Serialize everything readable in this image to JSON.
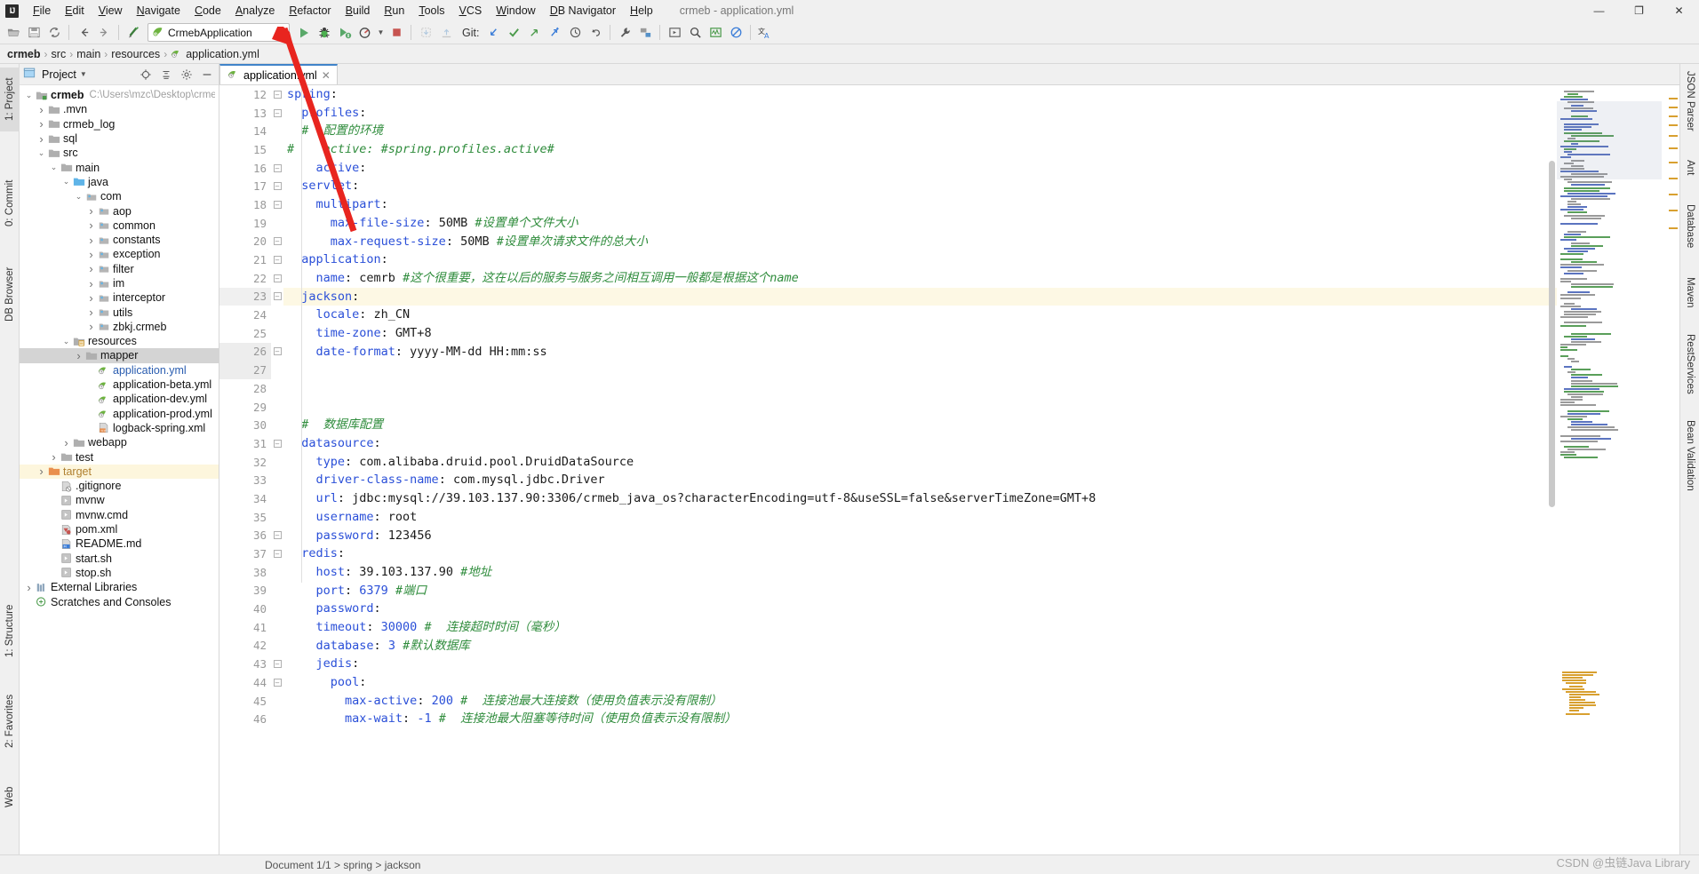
{
  "window": {
    "title": "crmeb - application.yml",
    "controls": {
      "minimize": "—",
      "maximize": "❐",
      "close": "✕"
    }
  },
  "menubar": {
    "items": [
      "File",
      "Edit",
      "View",
      "Navigate",
      "Code",
      "Analyze",
      "Refactor",
      "Build",
      "Run",
      "Tools",
      "VCS",
      "Window",
      "DB Navigator",
      "Help"
    ]
  },
  "toolbar": {
    "run_config": "CrmebApplication",
    "git_label": "Git:",
    "buttons": [
      "open-project-icon",
      "save-all-icon",
      "sync-icon",
      "back-icon",
      "forward-icon",
      "build-icon",
      "run-icon",
      "debug-icon",
      "run-coverage-icon",
      "profile-icon",
      "stop-icon",
      "update-project-icon",
      "commit-icon",
      "git-pull-icon",
      "git-commit-check-icon",
      "git-push-icon",
      "git-update-icon",
      "history-icon",
      "rollback-icon",
      "settings-wrench-icon",
      "project-structure-icon",
      "run-anything-icon",
      "search-everywhere-icon",
      "activity-monitor-icon",
      "no-access-icon",
      "translate-icon"
    ]
  },
  "breadcrumb": {
    "items": [
      "crmeb",
      "src",
      "main",
      "resources",
      "application.yml"
    ]
  },
  "left_tool_tabs": [
    "1: Project",
    "0: Commit",
    "DB Browser"
  ],
  "right_tool_tabs": [
    "JSON Parser",
    "Ant",
    "Database",
    "Maven",
    "RestServices",
    "Bean Validation"
  ],
  "bottom_left_tool_tabs": [
    "1: Structure",
    "2: Favorites",
    "Web"
  ],
  "project_panel": {
    "title": "Project",
    "header_icons": [
      "locate-icon",
      "collapse-all-icon",
      "gear-icon",
      "hide-icon"
    ],
    "tree": [
      {
        "label": "crmeb",
        "path": "C:\\Users\\mzc\\Desktop\\crmeb\\cr",
        "indent": 0,
        "arrow": "down",
        "icon": "module-folder",
        "bold": true
      },
      {
        "label": ".mvn",
        "indent": 1,
        "arrow": "right",
        "icon": "folder"
      },
      {
        "label": "crmeb_log",
        "indent": 1,
        "arrow": "right",
        "icon": "folder"
      },
      {
        "label": "sql",
        "indent": 1,
        "arrow": "right",
        "icon": "folder"
      },
      {
        "label": "src",
        "indent": 1,
        "arrow": "down",
        "icon": "folder"
      },
      {
        "label": "main",
        "indent": 2,
        "arrow": "down",
        "icon": "folder"
      },
      {
        "label": "java",
        "indent": 3,
        "arrow": "down",
        "icon": "source-folder"
      },
      {
        "label": "com",
        "indent": 4,
        "arrow": "down",
        "icon": "package"
      },
      {
        "label": "aop",
        "indent": 5,
        "arrow": "right",
        "icon": "package"
      },
      {
        "label": "common",
        "indent": 5,
        "arrow": "right",
        "icon": "package"
      },
      {
        "label": "constants",
        "indent": 5,
        "arrow": "right",
        "icon": "package"
      },
      {
        "label": "exception",
        "indent": 5,
        "arrow": "right",
        "icon": "package"
      },
      {
        "label": "filter",
        "indent": 5,
        "arrow": "right",
        "icon": "package"
      },
      {
        "label": "im",
        "indent": 5,
        "arrow": "right",
        "icon": "package"
      },
      {
        "label": "interceptor",
        "indent": 5,
        "arrow": "right",
        "icon": "package"
      },
      {
        "label": "utils",
        "indent": 5,
        "arrow": "right",
        "icon": "package"
      },
      {
        "label": "zbkj.crmeb",
        "indent": 5,
        "arrow": "right",
        "icon": "package"
      },
      {
        "label": "resources",
        "indent": 3,
        "arrow": "down",
        "icon": "resource-folder"
      },
      {
        "label": "mapper",
        "indent": 4,
        "arrow": "right",
        "icon": "folder",
        "selected": true
      },
      {
        "label": "application.yml",
        "indent": 5,
        "icon": "yml-file",
        "color": "blue"
      },
      {
        "label": "application-beta.yml",
        "indent": 5,
        "icon": "yml-file"
      },
      {
        "label": "application-dev.yml",
        "indent": 5,
        "icon": "yml-file"
      },
      {
        "label": "application-prod.yml",
        "indent": 5,
        "icon": "yml-file"
      },
      {
        "label": "logback-spring.xml",
        "indent": 5,
        "icon": "xml-file"
      },
      {
        "label": "webapp",
        "indent": 3,
        "arrow": "right",
        "icon": "folder"
      },
      {
        "label": "test",
        "indent": 2,
        "arrow": "right",
        "icon": "folder"
      },
      {
        "label": "target",
        "indent": 1,
        "arrow": "right",
        "icon": "excluded-folder",
        "color": "orange",
        "highlight": true
      },
      {
        "label": ".gitignore",
        "indent": 2,
        "icon": "gitignore-file"
      },
      {
        "label": "mvnw",
        "indent": 2,
        "icon": "script-file"
      },
      {
        "label": "mvnw.cmd",
        "indent": 2,
        "icon": "script-file"
      },
      {
        "label": "pom.xml",
        "indent": 2,
        "icon": "maven-file"
      },
      {
        "label": "README.md",
        "indent": 2,
        "icon": "md-file"
      },
      {
        "label": "start.sh",
        "indent": 2,
        "icon": "sh-file"
      },
      {
        "label": "stop.sh",
        "indent": 2,
        "icon": "sh-file"
      },
      {
        "label": "External Libraries",
        "indent": 0,
        "arrow": "right",
        "icon": "libraries"
      },
      {
        "label": "Scratches and Consoles",
        "indent": 0,
        "icon": "scratches"
      }
    ]
  },
  "editor": {
    "tab": {
      "label": "application.yml",
      "icon": "yml-file",
      "close": "✕"
    },
    "warning_count": "11",
    "first_line_number": 12,
    "lines": [
      {
        "n": 12,
        "fold": "minus",
        "tokens": [
          {
            "t": "spring",
            "c": "k"
          },
          {
            "t": ":",
            "c": "v"
          }
        ]
      },
      {
        "n": 13,
        "fold": "minus",
        "tokens": [
          {
            "t": "  profiles",
            "c": "k"
          },
          {
            "t": ":",
            "c": "v"
          }
        ]
      },
      {
        "n": 14,
        "tokens": [
          {
            "t": "  #  配置的环境",
            "c": "cm"
          }
        ]
      },
      {
        "n": 15,
        "tokens": [
          {
            "t": "#    active: #spring.profiles.active#",
            "c": "cm"
          }
        ]
      },
      {
        "n": 16,
        "fold": "minus",
        "tokens": [
          {
            "t": "    active",
            "c": "k"
          },
          {
            "t": ":",
            "c": "v"
          }
        ]
      },
      {
        "n": 17,
        "fold": "minus",
        "tokens": [
          {
            "t": "  servlet",
            "c": "k"
          },
          {
            "t": ":",
            "c": "v"
          }
        ]
      },
      {
        "n": 18,
        "fold": "minus",
        "tokens": [
          {
            "t": "    multipart",
            "c": "k"
          },
          {
            "t": ":",
            "c": "v"
          }
        ]
      },
      {
        "n": 19,
        "tokens": [
          {
            "t": "      max-file-size",
            "c": "k"
          },
          {
            "t": ": 50MB ",
            "c": "v"
          },
          {
            "t": "#设置单个文件大小",
            "c": "cm"
          }
        ]
      },
      {
        "n": 20,
        "fold": "minus",
        "tokens": [
          {
            "t": "      max-request-size",
            "c": "k"
          },
          {
            "t": ": 50MB ",
            "c": "v"
          },
          {
            "t": "#设置单次请求文件的总大小",
            "c": "cm"
          }
        ]
      },
      {
        "n": 21,
        "fold": "minus",
        "tokens": [
          {
            "t": "  application",
            "c": "k"
          },
          {
            "t": ":",
            "c": "v"
          }
        ]
      },
      {
        "n": 22,
        "fold": "minus",
        "tokens": [
          {
            "t": "    name",
            "c": "k"
          },
          {
            "t": ": cemrb ",
            "c": "v"
          },
          {
            "t": "#这个很重要，这在以后的服务与服务之间相互调用一般都是根据这个name",
            "c": "cm"
          }
        ]
      },
      {
        "n": 23,
        "fold": "minus",
        "highlight": true,
        "tokens": [
          {
            "t": "  jackson",
            "c": "k"
          },
          {
            "t": ":",
            "c": "v"
          }
        ]
      },
      {
        "n": 24,
        "tokens": [
          {
            "t": "    locale",
            "c": "k"
          },
          {
            "t": ": zh_CN",
            "c": "v"
          }
        ]
      },
      {
        "n": 25,
        "tokens": [
          {
            "t": "    time-zone",
            "c": "k"
          },
          {
            "t": ": GMT+8",
            "c": "v"
          }
        ]
      },
      {
        "n": 26,
        "fold": "minus",
        "tokens": [
          {
            "t": "    date-format",
            "c": "k"
          },
          {
            "t": ": yyyy-MM-dd HH:mm:ss",
            "c": "v"
          }
        ]
      },
      {
        "n": 27,
        "tokens": []
      },
      {
        "n": 28,
        "tokens": []
      },
      {
        "n": 29,
        "tokens": []
      },
      {
        "n": 30,
        "tokens": [
          {
            "t": "  #  数据库配置",
            "c": "cm"
          }
        ]
      },
      {
        "n": 31,
        "fold": "minus",
        "tokens": [
          {
            "t": "  datasource",
            "c": "k"
          },
          {
            "t": ":",
            "c": "v"
          }
        ]
      },
      {
        "n": 32,
        "tokens": [
          {
            "t": "    type",
            "c": "k"
          },
          {
            "t": ": com.alibaba.druid.pool.DruidDataSource",
            "c": "v"
          }
        ]
      },
      {
        "n": 33,
        "tokens": [
          {
            "t": "    driver-class-name",
            "c": "k"
          },
          {
            "t": ": com.mysql.jdbc.Driver",
            "c": "v"
          }
        ]
      },
      {
        "n": 34,
        "changed": true,
        "tokens": [
          {
            "t": "    url",
            "c": "k"
          },
          {
            "t": ": jdbc:mysql://39.103.137.90:3306/crmeb_java_os?characterEncoding=utf-8&useSSL=false&serverTimeZone=GMT+8",
            "c": "v"
          }
        ]
      },
      {
        "n": 35,
        "tokens": [
          {
            "t": "    username",
            "c": "k"
          },
          {
            "t": ": root",
            "c": "v"
          }
        ]
      },
      {
        "n": 36,
        "fold": "minus",
        "tokens": [
          {
            "t": "    password",
            "c": "k"
          },
          {
            "t": ": 123456",
            "c": "v"
          }
        ]
      },
      {
        "n": 37,
        "fold": "minus",
        "changed": true,
        "tokens": [
          {
            "t": "  redis",
            "c": "k"
          },
          {
            "t": ":",
            "c": "v"
          }
        ]
      },
      {
        "n": 38,
        "changed": true,
        "tokens": [
          {
            "t": "    host",
            "c": "k"
          },
          {
            "t": ": 39.103.137.90 ",
            "c": "v"
          },
          {
            "t": "#地址",
            "c": "cm"
          }
        ]
      },
      {
        "n": 39,
        "changed": true,
        "tokens": [
          {
            "t": "    port",
            "c": "k"
          },
          {
            "t": ": ",
            "c": "v"
          },
          {
            "t": "6379",
            "c": "num"
          },
          {
            "t": " ",
            "c": "v"
          },
          {
            "t": "#端口",
            "c": "cm"
          }
        ]
      },
      {
        "n": 40,
        "changed": true,
        "tokens": [
          {
            "t": "    password",
            "c": "k"
          },
          {
            "t": ":",
            "c": "v"
          }
        ]
      },
      {
        "n": 41,
        "changed": true,
        "tokens": [
          {
            "t": "    timeout",
            "c": "k"
          },
          {
            "t": ": ",
            "c": "v"
          },
          {
            "t": "30000",
            "c": "num"
          },
          {
            "t": " ",
            "c": "v"
          },
          {
            "t": "#  连接超时时间（毫秒）",
            "c": "cm"
          }
        ]
      },
      {
        "n": 42,
        "changed": true,
        "tokens": [
          {
            "t": "    database",
            "c": "k"
          },
          {
            "t": ": ",
            "c": "v"
          },
          {
            "t": "3",
            "c": "num"
          },
          {
            "t": " ",
            "c": "v"
          },
          {
            "t": "#默认数据库",
            "c": "cm"
          }
        ]
      },
      {
        "n": 43,
        "fold": "minus",
        "changed": true,
        "tokens": [
          {
            "t": "    jedis",
            "c": "k"
          },
          {
            "t": ":",
            "c": "v"
          }
        ]
      },
      {
        "n": 44,
        "fold": "minus",
        "changed": true,
        "tokens": [
          {
            "t": "      pool",
            "c": "k"
          },
          {
            "t": ":",
            "c": "v"
          }
        ]
      },
      {
        "n": 45,
        "changed": true,
        "tokens": [
          {
            "t": "        max-active",
            "c": "k"
          },
          {
            "t": ": ",
            "c": "v"
          },
          {
            "t": "200",
            "c": "num"
          },
          {
            "t": " ",
            "c": "v"
          },
          {
            "t": "#  连接池最大连接数（使用负值表示没有限制）",
            "c": "cm"
          }
        ]
      },
      {
        "n": 46,
        "changed": true,
        "tokens": [
          {
            "t": "        max-wait",
            "c": "k"
          },
          {
            "t": ": ",
            "c": "v"
          },
          {
            "t": "-1",
            "c": "num"
          },
          {
            "t": " ",
            "c": "v"
          },
          {
            "t": "#  连接池最大阻塞等待时间（使用负值表示没有限制）",
            "c": "cm"
          }
        ]
      }
    ]
  },
  "statusbar": {
    "text": "Document 1/1  >  spring  >  jackson"
  },
  "watermark": "CSDN @虫链Java Library",
  "colors": {
    "accent_blue": "#4083c9",
    "key_blue": "#2a4fd8",
    "comment_green": "#2f8c3c",
    "run_green": "#59a869",
    "stop_red": "#c75450",
    "warn_yellow": "#c9a227",
    "annotation_red": "#e8251f",
    "selection_gray": "#d4d4d4",
    "highlight_yellow": "#fdf6dd"
  }
}
